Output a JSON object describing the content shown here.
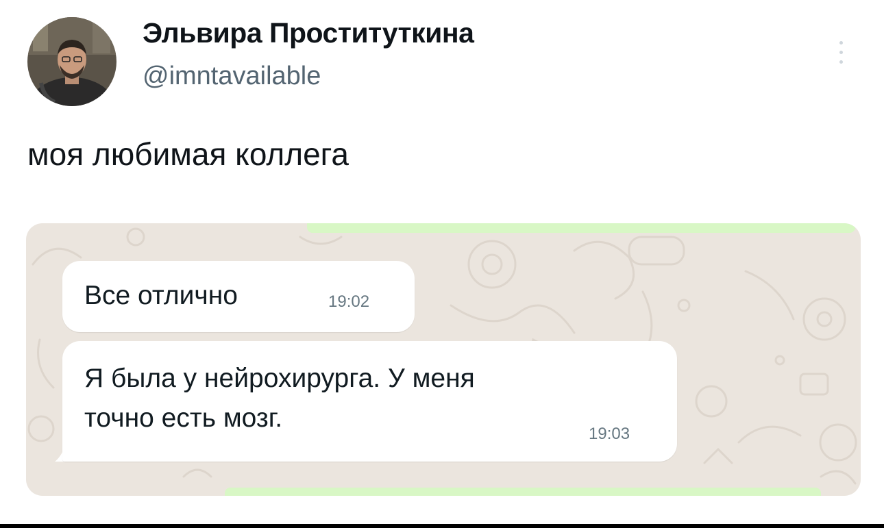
{
  "author": {
    "display_name": "Эльвира Проституткина",
    "handle": "@imntavailable",
    "avatar_icon": "user-photo-avatar"
  },
  "tweet": {
    "text": "моя любимая коллега"
  },
  "chat": {
    "background_color": "#ebe5de",
    "bubble_color": "#ffffff",
    "outgoing_color": "#d8f7c5",
    "messages": [
      {
        "line1": "Все отлично",
        "time": "19:02"
      },
      {
        "line1": "Я была у нейрохирурга. У меня",
        "line2": "точно есть мозг.",
        "time": "19:03"
      }
    ]
  },
  "icons": {
    "more": "more-vertical-icon"
  }
}
